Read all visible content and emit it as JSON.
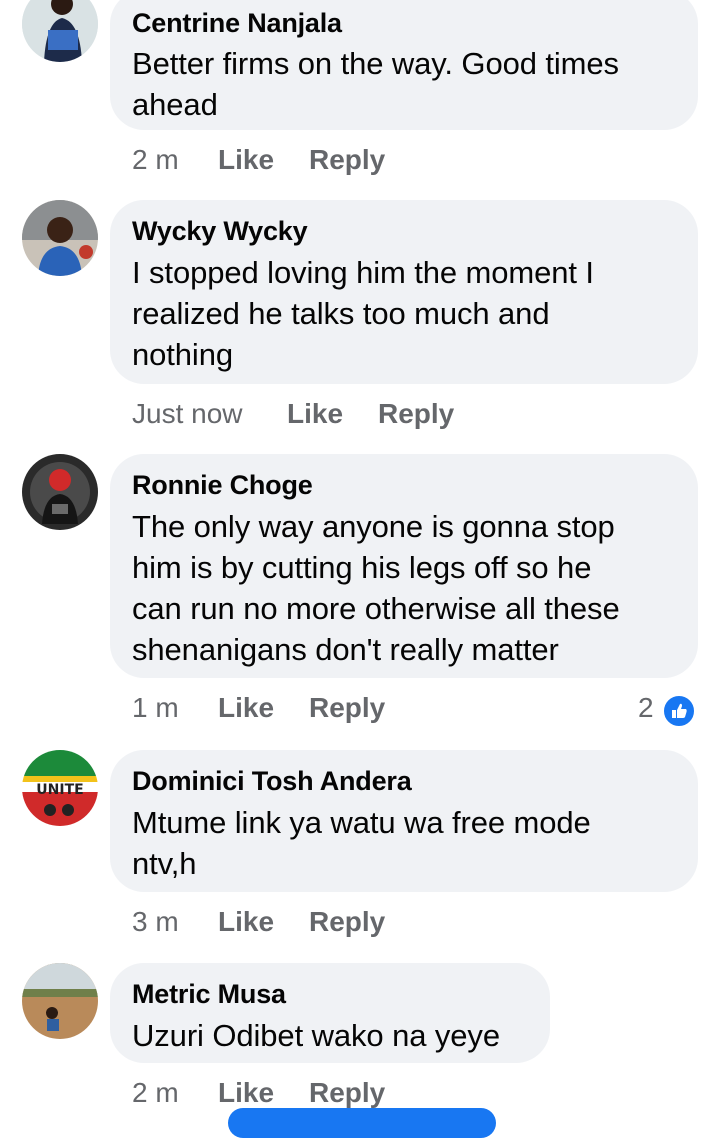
{
  "comments": [
    {
      "author": "Centrine Nanjala",
      "text_lines": [
        "Better firms on the way. Good times",
        "ahead"
      ],
      "time": "2 m",
      "like": "Like",
      "reply": "Reply"
    },
    {
      "author": "Wycky Wycky",
      "text_lines": [
        "I stopped loving him the moment I",
        "realized he talks too much and",
        "nothing"
      ],
      "time": "Just now",
      "like": "Like",
      "reply": "Reply"
    },
    {
      "author": "Ronnie Choge",
      "text_lines": [
        "The only way anyone is gonna stop",
        "him is by cutting his legs off so he",
        "can run no more otherwise all these",
        "shenanigans don't really matter"
      ],
      "time": "1 m",
      "like": "Like",
      "reply": "Reply",
      "reaction_count": "2",
      "reaction_icon": "thumbs-up-icon"
    },
    {
      "author": "Dominici Tosh Andera",
      "text_lines": [
        "Mtume link ya watu wa free mode",
        "ntv,h"
      ],
      "time": "3 m",
      "like": "Like",
      "reply": "Reply",
      "avatar_text": "UNITE"
    },
    {
      "author": "Metric Musa",
      "text_lines": [
        "Uzuri Odibet wako na yeye"
      ],
      "time": "2 m",
      "like": "Like",
      "reply": "Reply"
    }
  ],
  "colors": {
    "bubble": "#f0f2f5",
    "meta_text": "#65676b",
    "accent": "#1877f2"
  }
}
